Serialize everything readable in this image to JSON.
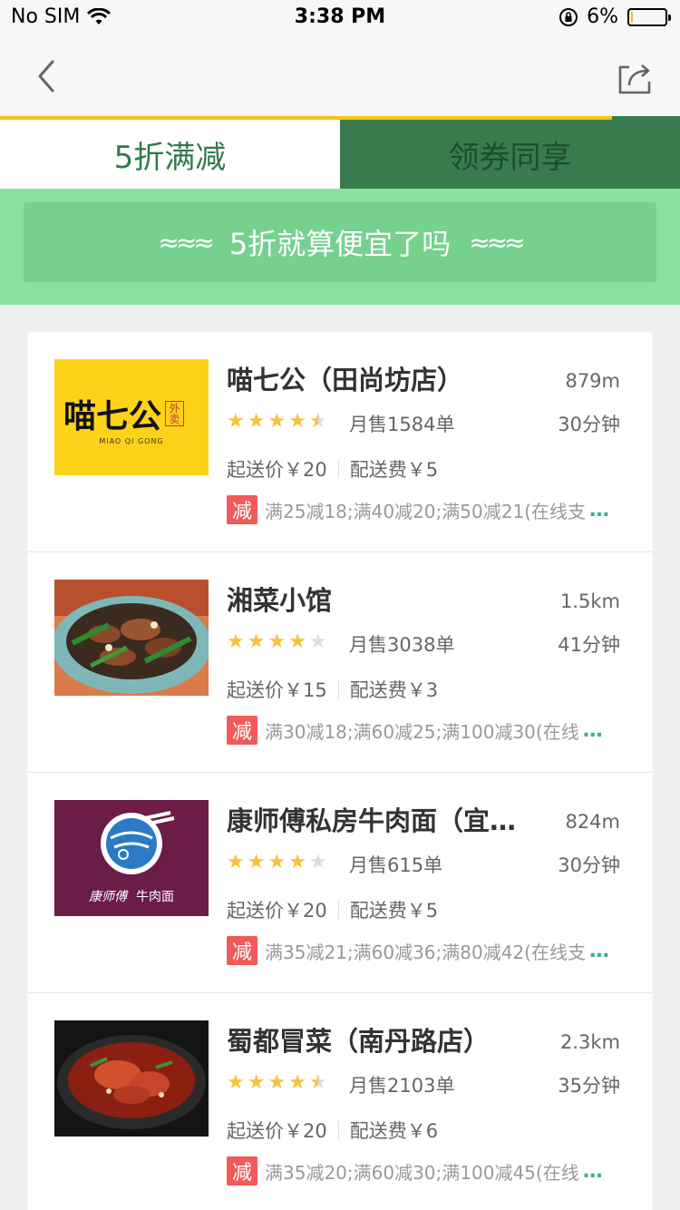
{
  "status_bar": {
    "carrier": "No SIM",
    "time": "3:38 PM",
    "battery_pct": "6%",
    "battery_level": 0.06
  },
  "tabs": [
    {
      "label": "5折满减"
    },
    {
      "label": "领券同享"
    }
  ],
  "banner": {
    "wave_left": "≈≈≈",
    "text": "5折就算便宜了吗",
    "wave_right": "≈≈≈"
  },
  "restaurants": [
    {
      "name": "喵七公（田尚坊店）",
      "distance": "879m",
      "rating": 4.5,
      "sales": "月售1584单",
      "time": "30分钟",
      "min_order": "起送价￥20",
      "delivery_fee": "配送费￥5",
      "promo_badge": "减",
      "promo": "满25减18;满40减20;满50减21(在线支",
      "more": "…",
      "logo_text": "喵七公",
      "logo_sub": "MIAO QI GONG",
      "logo_tag": "外卖"
    },
    {
      "name": "湘菜小馆",
      "distance": "1.5km",
      "rating": 4,
      "sales": "月售3038单",
      "time": "41分钟",
      "min_order": "起送价￥15",
      "delivery_fee": "配送费￥3",
      "promo_badge": "减",
      "promo": "满30减18;满60减25;满100减30(在线",
      "more": "…"
    },
    {
      "name": "康师傅私房牛肉面（宜…",
      "distance": "824m",
      "rating": 4,
      "sales": "月售615单",
      "time": "30分钟",
      "min_order": "起送价￥20",
      "delivery_fee": "配送费￥5",
      "promo_badge": "减",
      "promo": "满35减21;满60减36;满80减42(在线支",
      "more": "…",
      "logo_text": "康师傅",
      "logo_sub": "牛肉面"
    },
    {
      "name": "蜀都冒菜（南丹路店）",
      "distance": "2.3km",
      "rating": 4.5,
      "sales": "月售2103单",
      "time": "35分钟",
      "min_order": "起送价￥20",
      "delivery_fee": "配送费￥6",
      "promo_badge": "减",
      "promo": "满35减20;满60减30;满100减45(在线",
      "more": "…"
    }
  ],
  "colors": {
    "accent_green": "#3a7b4e",
    "tab_indicator": "#f5c518",
    "banner_bg": "#88e29e",
    "promo_red": "#f25a5a",
    "star": "#f8c23c"
  }
}
